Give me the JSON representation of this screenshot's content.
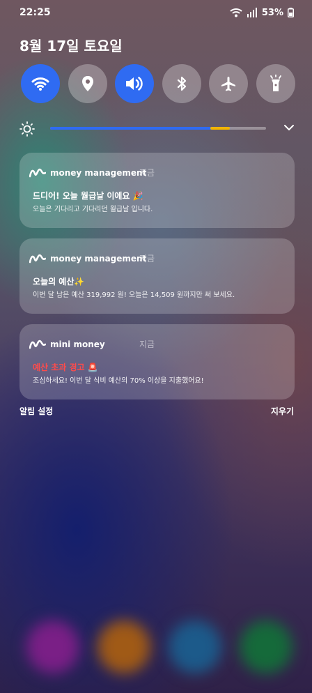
{
  "status": {
    "time": "22:25",
    "battery_percent": "53%"
  },
  "date": "8월 17일 토요일",
  "quick_settings": [
    {
      "name": "wifi",
      "active": true
    },
    {
      "name": "location",
      "active": false
    },
    {
      "name": "sound",
      "active": true
    },
    {
      "name": "bluetooth",
      "active": false
    },
    {
      "name": "airplane-mode",
      "active": false
    },
    {
      "name": "flashlight",
      "active": false
    }
  ],
  "brightness": {
    "level": 0.78
  },
  "notifications": [
    {
      "app": "money management",
      "time": "지금",
      "title": "드디어! 오늘 월급날 이에요 🎉",
      "body": "오늘은 기다리고 기다리던 월급날 입니다."
    },
    {
      "app": "money management",
      "time": "지금",
      "title": "오늘의 예산✨",
      "body": "이번 달 남은 예산 319,992 원! 오늘은 14,509 원까지만 써 보세요."
    },
    {
      "app": "mini money",
      "time": "지금",
      "title": "예산 초과 경고 🚨",
      "body": "조심하세요! 이번 달 식비 예산의 70% 이상을 지출했어요!",
      "title_color": "#ff4b4b"
    }
  ],
  "footer": {
    "settings_label": "알림 설정",
    "clear_label": "지우기"
  },
  "colors": {
    "accent": "#2f6bf2",
    "warning_title": "#ff4b4b",
    "brightness_marker": "#f2b400"
  }
}
